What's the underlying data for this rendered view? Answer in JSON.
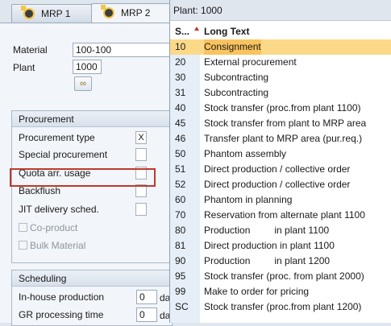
{
  "tabs": [
    {
      "label": "MRP 1",
      "icon": "mrp-icon"
    },
    {
      "label": "MRP 2",
      "icon": "mrp-icon"
    }
  ],
  "form": {
    "material_label": "Material",
    "material_value": "100-100",
    "plant_label": "Plant",
    "plant_value": "1000"
  },
  "procurement": {
    "title": "Procurement",
    "rows": [
      {
        "label": "Procurement type",
        "value": "X"
      },
      {
        "label": "Special procurement",
        "value": ""
      },
      {
        "label": "Quota arr. usage",
        "value": ""
      },
      {
        "label": "Backflush",
        "value": ""
      },
      {
        "label": "JIT delivery sched.",
        "value": ""
      }
    ],
    "co_product": "Co-product",
    "bulk_material": "Bulk Material"
  },
  "scheduling": {
    "title": "Scheduling",
    "inhouse_label": "In-house production",
    "inhouse_value": "0",
    "inhouse_unit": "da",
    "gr_label": "GR processing time",
    "gr_value": "0",
    "gr_unit": "da"
  },
  "popup": {
    "header": "Plant: 1000",
    "col_key": "S...",
    "col_text": "Long Text",
    "selected_index": 0,
    "items": [
      {
        "key": "10",
        "text": "Consignment"
      },
      {
        "key": "20",
        "text": "External procurement"
      },
      {
        "key": "30",
        "text": "Subcontracting"
      },
      {
        "key": "31",
        "text": "Subcontracting"
      },
      {
        "key": "40",
        "text": "Stock transfer (proc.from plant 1100)"
      },
      {
        "key": "45",
        "text": "Stock transfer from plant to MRP area"
      },
      {
        "key": "46",
        "text": "Transfer plant to MRP area (pur.req.)"
      },
      {
        "key": "50",
        "text": "Phantom assembly"
      },
      {
        "key": "51",
        "text": "Direct production / collective order"
      },
      {
        "key": "52",
        "text": "Direct production / collective order"
      },
      {
        "key": "60",
        "text": "Phantom in planning"
      },
      {
        "key": "70",
        "text": "Reservation from alternate plant 1100"
      },
      {
        "key": "80",
        "text": "Production         in plant 1100"
      },
      {
        "key": "81",
        "text": "Direct production in plant 1100"
      },
      {
        "key": "90",
        "text": "Production         in plant 1200"
      },
      {
        "key": "95",
        "text": "Stock transfer (proc. from plant 2000)"
      },
      {
        "key": "99",
        "text": "Make to order for pricing"
      },
      {
        "key": "SC",
        "text": "Stock transfer (proc.from plant 1200)"
      }
    ]
  },
  "colors": {
    "selection_row": "#fbd989",
    "highlight_border": "#c0392b",
    "key_column": "#e6eff8"
  }
}
